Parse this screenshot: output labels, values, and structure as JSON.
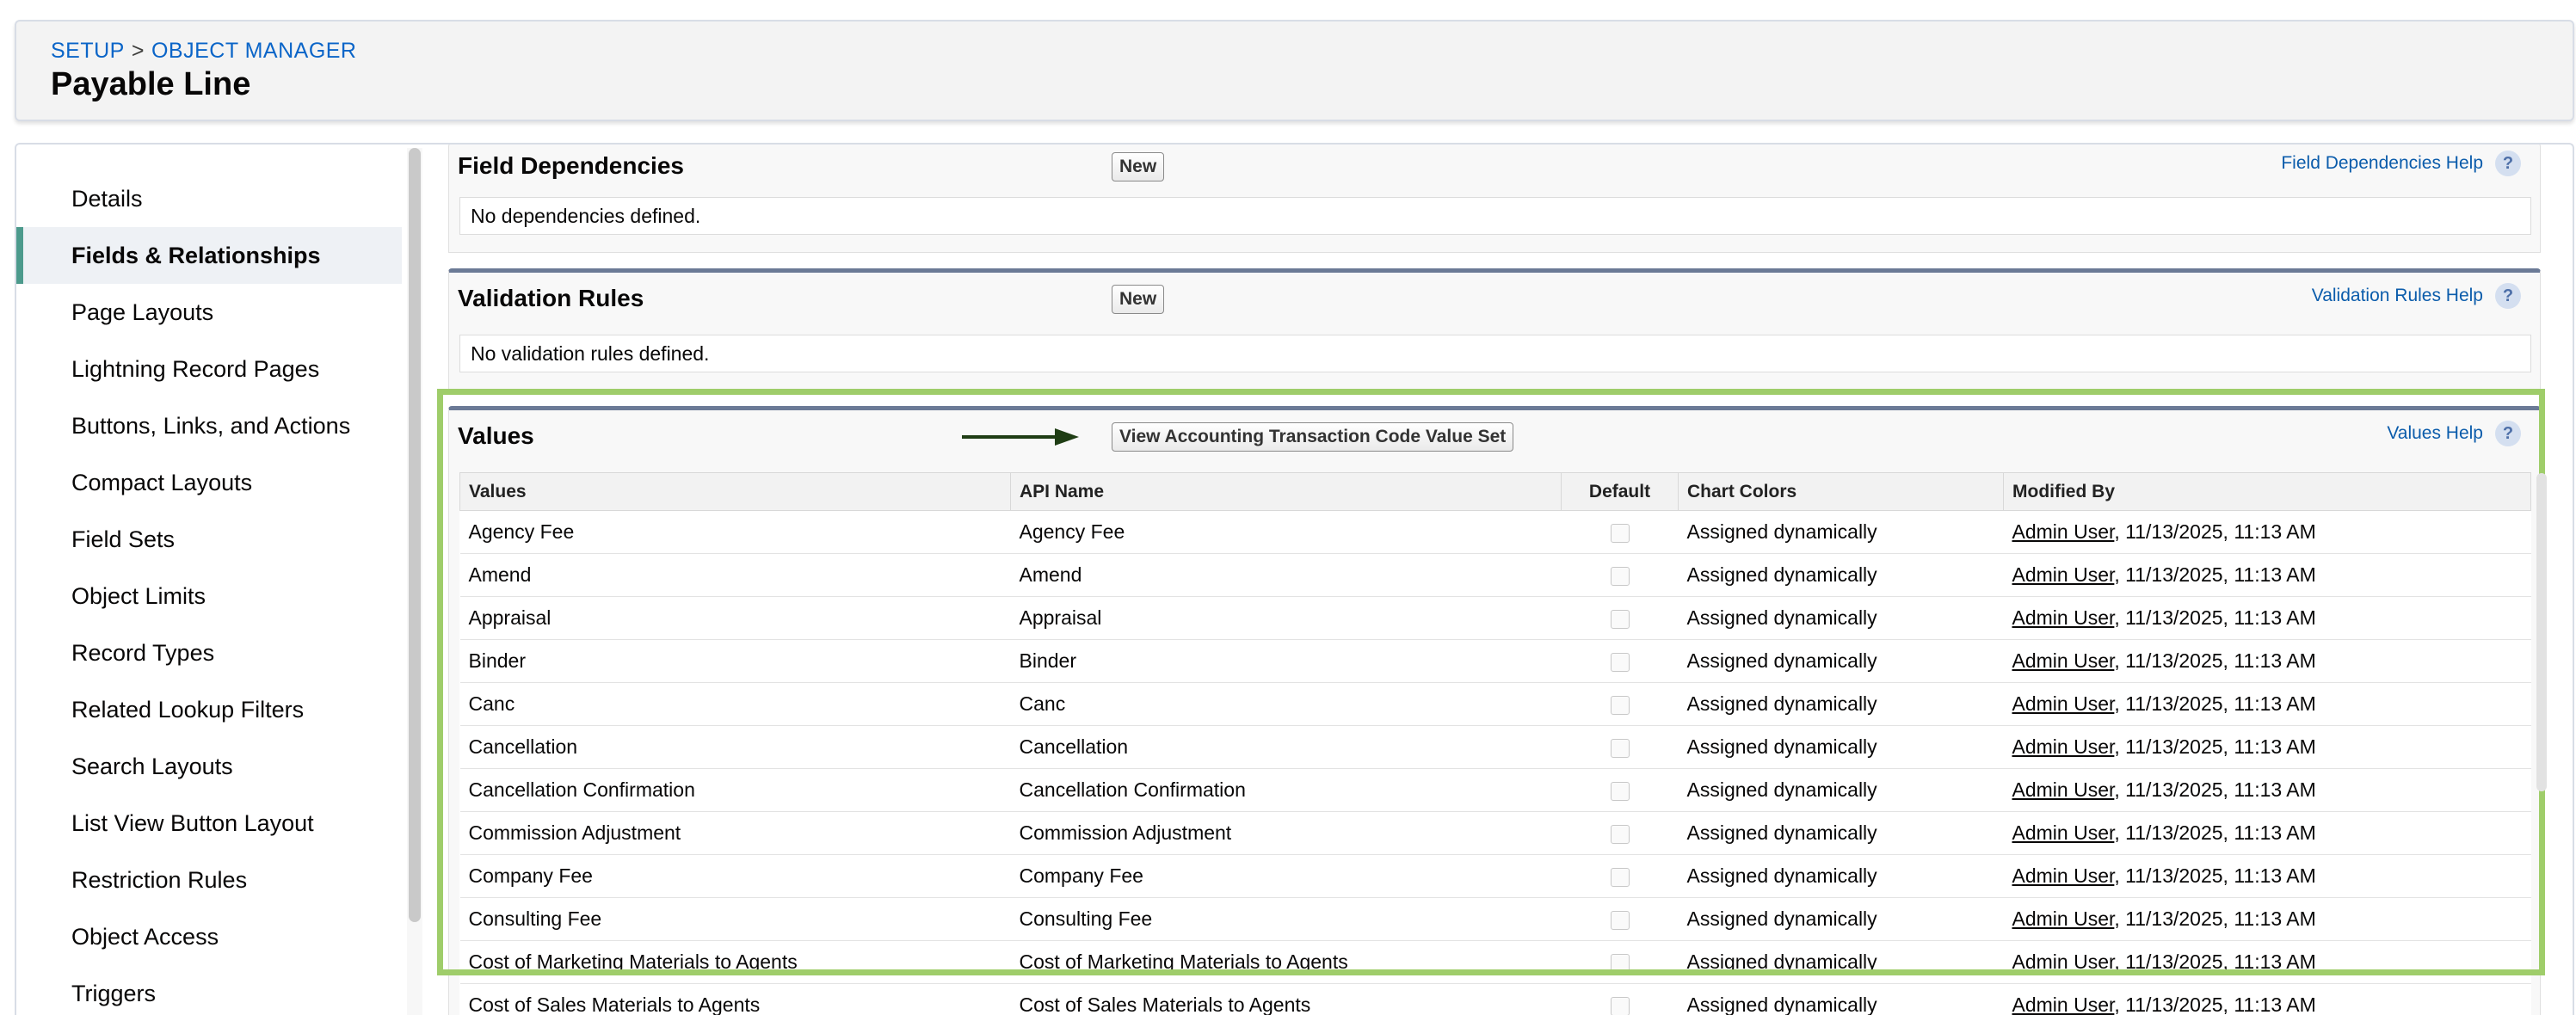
{
  "breadcrumb": {
    "setup": "SETUP",
    "separator": ">",
    "object_manager": "OBJECT MANAGER"
  },
  "page_title": "Payable Line",
  "sidebar": {
    "items": [
      {
        "label": "Details",
        "active": false
      },
      {
        "label": "Fields & Relationships",
        "active": true
      },
      {
        "label": "Page Layouts",
        "active": false
      },
      {
        "label": "Lightning Record Pages",
        "active": false
      },
      {
        "label": "Buttons, Links, and Actions",
        "active": false
      },
      {
        "label": "Compact Layouts",
        "active": false
      },
      {
        "label": "Field Sets",
        "active": false
      },
      {
        "label": "Object Limits",
        "active": false
      },
      {
        "label": "Record Types",
        "active": false
      },
      {
        "label": "Related Lookup Filters",
        "active": false
      },
      {
        "label": "Search Layouts",
        "active": false
      },
      {
        "label": "List View Button Layout",
        "active": false
      },
      {
        "label": "Restriction Rules",
        "active": false
      },
      {
        "label": "Object Access",
        "active": false
      },
      {
        "label": "Triggers",
        "active": false
      }
    ]
  },
  "field_dependencies": {
    "title": "Field Dependencies",
    "new_label": "New",
    "help_label": "Field Dependencies Help",
    "message": "No dependencies defined."
  },
  "validation_rules": {
    "title": "Validation Rules",
    "new_label": "New",
    "help_label": "Validation Rules Help",
    "message": "No validation rules defined."
  },
  "values": {
    "title": "Values",
    "view_button_label": "View Accounting Transaction Code Value Set",
    "help_label": "Values Help",
    "columns": [
      "Values",
      "API Name",
      "Default",
      "Chart Colors",
      "Modified By"
    ],
    "rows": [
      {
        "value": "Agency Fee",
        "api": "Agency Fee",
        "chart": "Assigned dynamically",
        "user": "Admin User",
        "date": ", 11/13/2025, 11:13 AM"
      },
      {
        "value": "Amend",
        "api": "Amend",
        "chart": "Assigned dynamically",
        "user": "Admin User",
        "date": ", 11/13/2025, 11:13 AM"
      },
      {
        "value": "Appraisal",
        "api": "Appraisal",
        "chart": "Assigned dynamically",
        "user": "Admin User",
        "date": ", 11/13/2025, 11:13 AM"
      },
      {
        "value": "Binder",
        "api": "Binder",
        "chart": "Assigned dynamically",
        "user": "Admin User",
        "date": ", 11/13/2025, 11:13 AM"
      },
      {
        "value": "Canc",
        "api": "Canc",
        "chart": "Assigned dynamically",
        "user": "Admin User",
        "date": ", 11/13/2025, 11:13 AM"
      },
      {
        "value": "Cancellation",
        "api": "Cancellation",
        "chart": "Assigned dynamically",
        "user": "Admin User",
        "date": ", 11/13/2025, 11:13 AM"
      },
      {
        "value": "Cancellation Confirmation",
        "api": "Cancellation Confirmation",
        "chart": "Assigned dynamically",
        "user": "Admin User",
        "date": ", 11/13/2025, 11:13 AM"
      },
      {
        "value": "Commission Adjustment",
        "api": "Commission Adjustment",
        "chart": "Assigned dynamically",
        "user": "Admin User",
        "date": ", 11/13/2025, 11:13 AM"
      },
      {
        "value": "Company Fee",
        "api": "Company Fee",
        "chart": "Assigned dynamically",
        "user": "Admin User",
        "date": ", 11/13/2025, 11:13 AM"
      },
      {
        "value": "Consulting Fee",
        "api": "Consulting Fee",
        "chart": "Assigned dynamically",
        "user": "Admin User",
        "date": ", 11/13/2025, 11:13 AM"
      },
      {
        "value": "Cost of Marketing Materials to Agents",
        "api": "Cost of Marketing Materials to Agents",
        "chart": "Assigned dynamically",
        "user": "Admin User",
        "date": ", 11/13/2025, 11:13 AM"
      },
      {
        "value": "Cost of Sales Materials to Agents",
        "api": "Cost of Sales Materials to Agents",
        "chart": "Assigned dynamically",
        "user": "Admin User",
        "date": ", 11/13/2025, 11:13 AM"
      }
    ]
  },
  "colors": {
    "link": "#0b65c8",
    "active_marker": "#4c9a8c",
    "highlight": "#9fcd6a",
    "section_top": "#6b7a96"
  },
  "icons": {
    "help": "question-circle-icon",
    "arrow": "arrow-right-icon"
  }
}
